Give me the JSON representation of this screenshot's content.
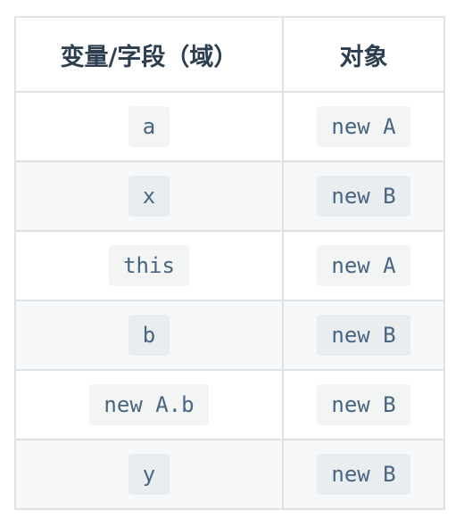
{
  "table": {
    "headers": [
      "变量/字段（域）",
      "对象"
    ],
    "rows": [
      {
        "variable": "a",
        "object": "new A"
      },
      {
        "variable": "x",
        "object": "new B"
      },
      {
        "variable": "this",
        "object": "new A"
      },
      {
        "variable": "b",
        "object": "new B"
      },
      {
        "variable": "new A.b",
        "object": "new B"
      },
      {
        "variable": "y",
        "object": "new B"
      }
    ]
  },
  "colors": {
    "border": "#dfe2e5",
    "header_text": "#2c3e50",
    "code_text": "#476582",
    "stripe_background": "#f6f8fa"
  }
}
